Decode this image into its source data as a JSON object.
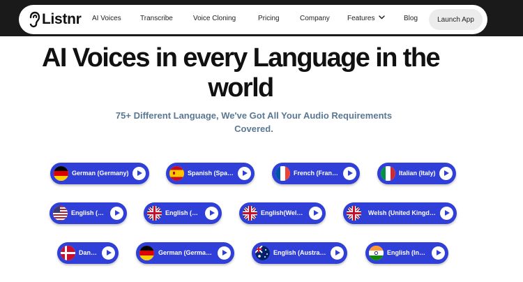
{
  "nav": {
    "brand": "Listnr",
    "links": [
      "AI Voices",
      "Transcribe",
      "Voice Cloning",
      "Pricing",
      "Company",
      "Features",
      "Blog"
    ],
    "cta": "Launch App"
  },
  "hero": {
    "title": "AI Voices in every Language in the world",
    "subtitle": "75+ Different Language, We've Got All Your Audio Requirements Covered."
  },
  "languages": [
    {
      "label": "German (Germany)",
      "flag": "germany-flag-icon"
    },
    {
      "label": "Spanish (Spain)",
      "flag": "spain-flag-icon"
    },
    {
      "label": "French (France)",
      "flag": "france-flag-icon"
    },
    {
      "label": "Italian (Italy)",
      "flag": "italy-flag-icon"
    },
    {
      "label": "English (US)",
      "flag": "usa-flag-icon"
    },
    {
      "label": "English (UK)",
      "flag": "uk-flag-icon"
    },
    {
      "label": "English(Welsh)",
      "flag": "uk-flag-icon"
    },
    {
      "label": "Welsh (United Kingdom)",
      "flag": "uk-flag-icon"
    },
    {
      "label": "Danish",
      "flag": "denmark-flag-icon"
    },
    {
      "label": "German (Germany)",
      "flag": "germany-flag-icon"
    },
    {
      "label": "English (Australia)",
      "flag": "australia-flag-icon"
    },
    {
      "label": "English (India)",
      "flag": "india-flag-icon"
    }
  ],
  "colors": {
    "pill": "#2f3fd8",
    "subtitle": "#5a7893",
    "topband": "#1a1a1a"
  }
}
